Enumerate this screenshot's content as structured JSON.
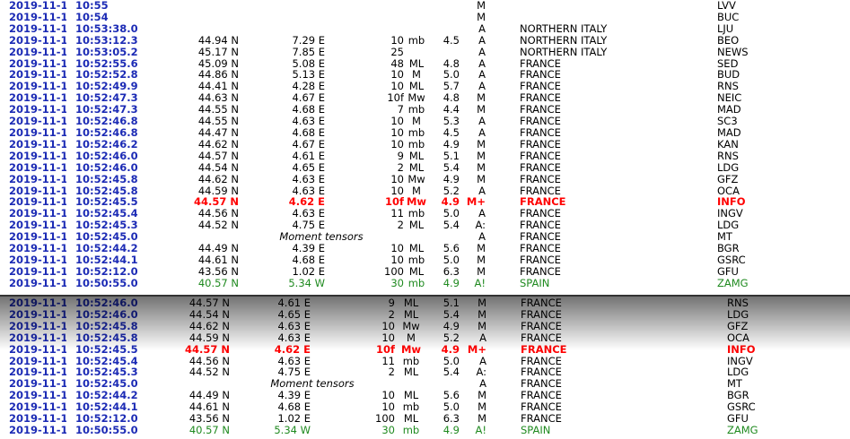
{
  "top_rows": [
    {
      "date": "2019-11-11",
      "time": "10:55",
      "lat": "",
      "lon": "",
      "depth": "",
      "mtype": "",
      "mag": "",
      "qual": "M",
      "region": "",
      "agency": "LVV",
      "style": ""
    },
    {
      "date": "2019-11-11",
      "time": "10:54",
      "lat": "",
      "lon": "",
      "depth": "",
      "mtype": "",
      "mag": "",
      "qual": "M",
      "region": "",
      "agency": "BUC",
      "style": ""
    },
    {
      "date": "2019-11-11",
      "time": "10:53:38.0",
      "lat": "",
      "lon": "",
      "depth": "",
      "mtype": "",
      "mag": "",
      "qual": "A",
      "region": "NORTHERN ITALY",
      "agency": "LJU",
      "style": ""
    },
    {
      "date": "2019-11-11",
      "time": "10:53:12.3",
      "lat": "44.94 N",
      "lon": "7.29 E",
      "depth": "10",
      "mtype": "mb",
      "mag": "4.5",
      "qual": "A",
      "region": "NORTHERN ITALY",
      "agency": "BEO",
      "style": ""
    },
    {
      "date": "2019-11-11",
      "time": "10:53:05.2",
      "lat": "45.17 N",
      "lon": "7.85 E",
      "depth": "25",
      "mtype": "",
      "mag": "",
      "qual": "A",
      "region": "NORTHERN ITALY",
      "agency": "NEWS",
      "style": ""
    },
    {
      "date": "2019-11-11",
      "time": "10:52:55.6",
      "lat": "45.09 N",
      "lon": "5.08 E",
      "depth": "48",
      "mtype": "ML",
      "mag": "4.8",
      "qual": "A",
      "region": "FRANCE",
      "agency": "SED",
      "style": ""
    },
    {
      "date": "2019-11-11",
      "time": "10:52:52.8",
      "lat": "44.86 N",
      "lon": "5.13 E",
      "depth": "10",
      "mtype": "M",
      "mag": "5.0",
      "qual": "A",
      "region": "FRANCE",
      "agency": "BUD",
      "style": ""
    },
    {
      "date": "2019-11-11",
      "time": "10:52:49.9",
      "lat": "44.41 N",
      "lon": "4.28 E",
      "depth": "10",
      "mtype": "ML",
      "mag": "5.7",
      "qual": "A",
      "region": "FRANCE",
      "agency": "RNS",
      "style": ""
    },
    {
      "date": "2019-11-11",
      "time": "10:52:47.3",
      "lat": "44.63 N",
      "lon": "4.67 E",
      "depth": "10f",
      "mtype": "Mw",
      "mag": "4.8",
      "qual": "M",
      "region": "FRANCE",
      "agency": "NEIC",
      "style": ""
    },
    {
      "date": "2019-11-11",
      "time": "10:52:47.3",
      "lat": "44.55 N",
      "lon": "4.68 E",
      "depth": "7",
      "mtype": "mb",
      "mag": "4.4",
      "qual": "M",
      "region": "FRANCE",
      "agency": "MAD",
      "style": ""
    },
    {
      "date": "2019-11-11",
      "time": "10:52:46.8",
      "lat": "44.55 N",
      "lon": "4.63 E",
      "depth": "10",
      "mtype": "M",
      "mag": "5.3",
      "qual": "A",
      "region": "FRANCE",
      "agency": "SC3",
      "style": ""
    },
    {
      "date": "2019-11-11",
      "time": "10:52:46.8",
      "lat": "44.47 N",
      "lon": "4.68 E",
      "depth": "10",
      "mtype": "mb",
      "mag": "4.5",
      "qual": "A",
      "region": "FRANCE",
      "agency": "MAD",
      "style": ""
    },
    {
      "date": "2019-11-11",
      "time": "10:52:46.2",
      "lat": "44.62 N",
      "lon": "4.67 E",
      "depth": "10",
      "mtype": "mb",
      "mag": "4.9",
      "qual": "M",
      "region": "FRANCE",
      "agency": "KAN",
      "style": ""
    },
    {
      "date": "2019-11-11",
      "time": "10:52:46.0",
      "lat": "44.57 N",
      "lon": "4.61 E",
      "depth": "9",
      "mtype": "ML",
      "mag": "5.1",
      "qual": "M",
      "region": "FRANCE",
      "agency": "RNS",
      "style": ""
    },
    {
      "date": "2019-11-11",
      "time": "10:52:46.0",
      "lat": "44.54 N",
      "lon": "4.65 E",
      "depth": "2",
      "mtype": "ML",
      "mag": "5.4",
      "qual": "M",
      "region": "FRANCE",
      "agency": "LDG",
      "style": ""
    },
    {
      "date": "2019-11-11",
      "time": "10:52:45.8",
      "lat": "44.62 N",
      "lon": "4.63 E",
      "depth": "10",
      "mtype": "Mw",
      "mag": "4.9",
      "qual": "M",
      "region": "FRANCE",
      "agency": "GFZ",
      "style": ""
    },
    {
      "date": "2019-11-11",
      "time": "10:52:45.8",
      "lat": "44.59 N",
      "lon": "4.63 E",
      "depth": "10",
      "mtype": "M",
      "mag": "5.2",
      "qual": "A",
      "region": "FRANCE",
      "agency": "OCA",
      "style": ""
    },
    {
      "date": "2019-11-11",
      "time": "10:52:45.5",
      "lat": "44.57 N",
      "lon": "4.62 E",
      "depth": "10f",
      "mtype": "Mw",
      "mag": "4.9",
      "qual": "M+",
      "region": "FRANCE",
      "agency": "INFO",
      "style": "info"
    },
    {
      "date": "2019-11-11",
      "time": "10:52:45.4",
      "lat": "44.56 N",
      "lon": "4.63 E",
      "depth": "11",
      "mtype": "mb",
      "mag": "5.0",
      "qual": "A",
      "region": "FRANCE",
      "agency": "INGV",
      "style": ""
    },
    {
      "date": "2019-11-11",
      "time": "10:52:45.3",
      "lat": "44.52 N",
      "lon": "4.75 E",
      "depth": "2",
      "mtype": "ML",
      "mag": "5.4",
      "qual": "A:",
      "region": "FRANCE",
      "agency": "LDG",
      "style": ""
    },
    {
      "date": "2019-11-11",
      "time": "10:52:45.0",
      "lat": "",
      "lon": "",
      "depth": "",
      "mtype": "",
      "mag": "",
      "qual": "A",
      "region": "FRANCE",
      "agency": "MT",
      "style": "mt",
      "note": "Moment tensors"
    },
    {
      "date": "2019-11-11",
      "time": "10:52:44.2",
      "lat": "44.49 N",
      "lon": "4.39 E",
      "depth": "10",
      "mtype": "ML",
      "mag": "5.6",
      "qual": "M",
      "region": "FRANCE",
      "agency": "BGR",
      "style": ""
    },
    {
      "date": "2019-11-11",
      "time": "10:52:44.1",
      "lat": "44.61 N",
      "lon": "4.68 E",
      "depth": "10",
      "mtype": "mb",
      "mag": "5.0",
      "qual": "M",
      "region": "FRANCE",
      "agency": "GSRC",
      "style": ""
    },
    {
      "date": "2019-11-11",
      "time": "10:52:12.0",
      "lat": "43.56 N",
      "lon": "1.02 E",
      "depth": "100",
      "mtype": "ML",
      "mag": "6.3",
      "qual": "M",
      "region": "FRANCE",
      "agency": "GFU",
      "style": ""
    },
    {
      "date": "2019-11-11",
      "time": "10:50:55.0",
      "lat": "40.57 N",
      "lon": "5.34 W",
      "depth": "30",
      "mtype": "mb",
      "mag": "4.9",
      "qual": "A!",
      "region": "SPAIN",
      "agency": "ZAMG",
      "style": "spain"
    }
  ],
  "bottom_rows": [
    {
      "date": "2019-11-11",
      "time": "10:52:46.0",
      "lat": "44.57 N",
      "lon": "4.61 E",
      "depth": "9",
      "mtype": "ML",
      "mag": "5.1",
      "qual": "M",
      "region": "FRANCE",
      "agency": "RNS",
      "style": ""
    },
    {
      "date": "2019-11-11",
      "time": "10:52:46.0",
      "lat": "44.54 N",
      "lon": "4.65 E",
      "depth": "2",
      "mtype": "ML",
      "mag": "5.4",
      "qual": "M",
      "region": "FRANCE",
      "agency": "LDG",
      "style": ""
    },
    {
      "date": "2019-11-11",
      "time": "10:52:45.8",
      "lat": "44.62 N",
      "lon": "4.63 E",
      "depth": "10",
      "mtype": "Mw",
      "mag": "4.9",
      "qual": "M",
      "region": "FRANCE",
      "agency": "GFZ",
      "style": ""
    },
    {
      "date": "2019-11-11",
      "time": "10:52:45.8",
      "lat": "44.59 N",
      "lon": "4.63 E",
      "depth": "10",
      "mtype": "M",
      "mag": "5.2",
      "qual": "A",
      "region": "FRANCE",
      "agency": "OCA",
      "style": ""
    },
    {
      "date": "2019-11-11",
      "time": "10:52:45.5",
      "lat": "44.57 N",
      "lon": "4.62 E",
      "depth": "10f",
      "mtype": "Mw",
      "mag": "4.9",
      "qual": "M+",
      "region": "FRANCE",
      "agency": "INFO",
      "style": "info"
    },
    {
      "date": "2019-11-11",
      "time": "10:52:45.4",
      "lat": "44.56 N",
      "lon": "4.63 E",
      "depth": "11",
      "mtype": "mb",
      "mag": "5.0",
      "qual": "A",
      "region": "FRANCE",
      "agency": "INGV",
      "style": ""
    },
    {
      "date": "2019-11-11",
      "time": "10:52:45.3",
      "lat": "44.52 N",
      "lon": "4.75 E",
      "depth": "2",
      "mtype": "ML",
      "mag": "5.4",
      "qual": "A:",
      "region": "FRANCE",
      "agency": "LDG",
      "style": ""
    },
    {
      "date": "2019-11-11",
      "time": "10:52:45.0",
      "lat": "",
      "lon": "",
      "depth": "",
      "mtype": "",
      "mag": "",
      "qual": "A",
      "region": "FRANCE",
      "agency": "MT",
      "style": "mt",
      "note": "Moment tensors"
    },
    {
      "date": "2019-11-11",
      "time": "10:52:44.2",
      "lat": "44.49 N",
      "lon": "4.39 E",
      "depth": "10",
      "mtype": "ML",
      "mag": "5.6",
      "qual": "M",
      "region": "FRANCE",
      "agency": "BGR",
      "style": ""
    },
    {
      "date": "2019-11-11",
      "time": "10:52:44.1",
      "lat": "44.61 N",
      "lon": "4.68 E",
      "depth": "10",
      "mtype": "mb",
      "mag": "5.0",
      "qual": "M",
      "region": "FRANCE",
      "agency": "GSRC",
      "style": ""
    },
    {
      "date": "2019-11-11",
      "time": "10:52:12.0",
      "lat": "43.56 N",
      "lon": "1.02 E",
      "depth": "100",
      "mtype": "ML",
      "mag": "6.3",
      "qual": "M",
      "region": "FRANCE",
      "agency": "GFU",
      "style": ""
    },
    {
      "date": "2019-11-11",
      "time": "10:50:55.0",
      "lat": "40.57 N",
      "lon": "5.34 W",
      "depth": "30",
      "mtype": "mb",
      "mag": "4.9",
      "qual": "A!",
      "region": "SPAIN",
      "agency": "ZAMG",
      "style": "spain"
    }
  ],
  "colors": {
    "datetime": "#1c2bb5",
    "highlight": "#ff0000",
    "spain": "#1f8a1f"
  }
}
